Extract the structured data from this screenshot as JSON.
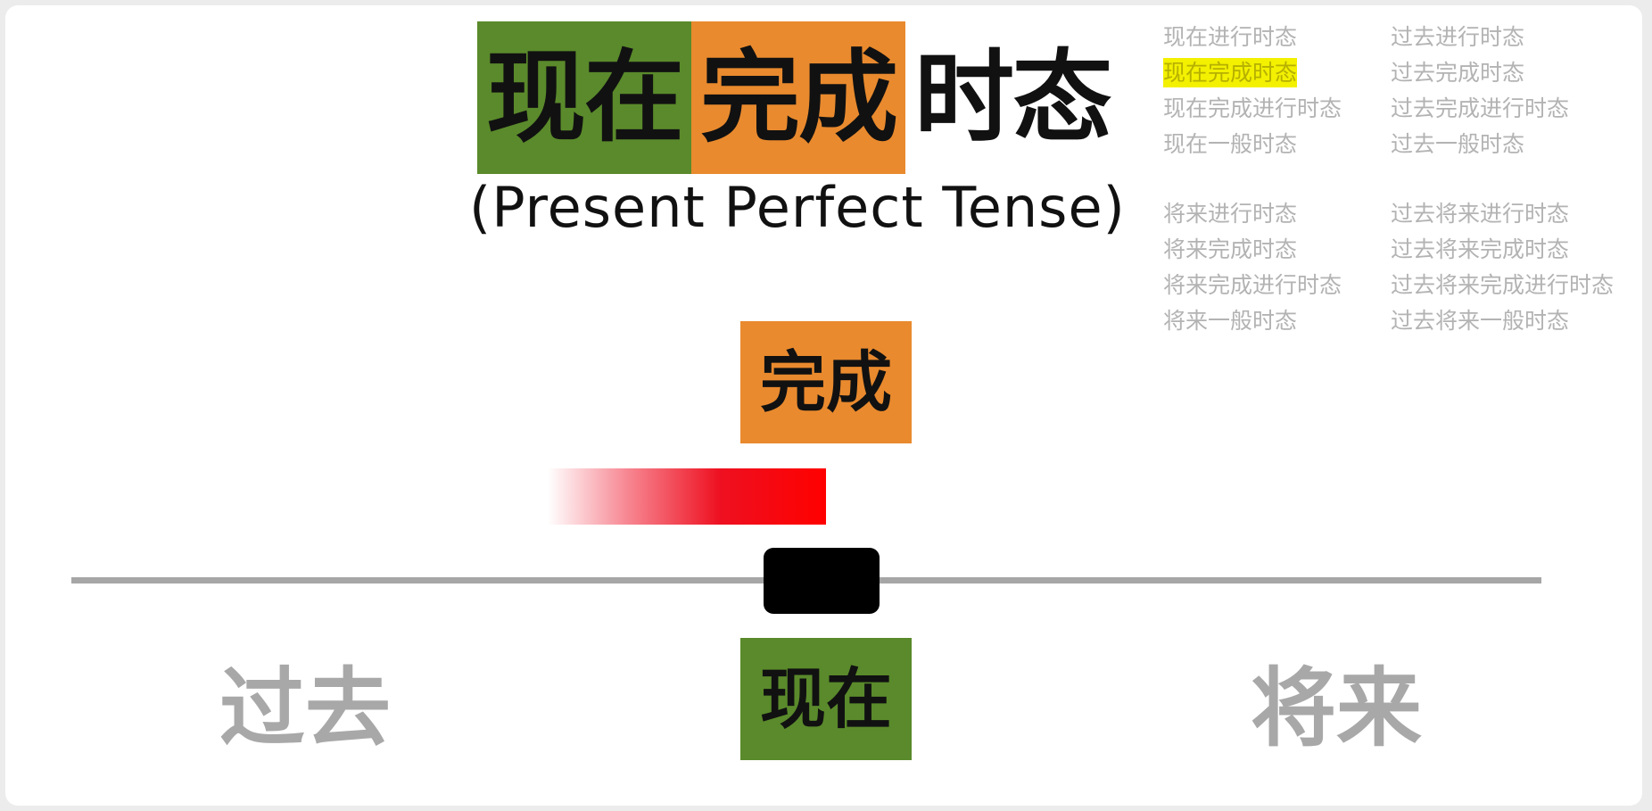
{
  "title": {
    "part_present": "现在",
    "part_perfect": "完成",
    "part_tense": "时态",
    "english": "(Present Perfect Tense)"
  },
  "colors": {
    "present_green": "#5a8a2b",
    "perfect_orange": "#e98a2e",
    "duration_red": "#ff0000",
    "highlight_yellow": "#f3f000",
    "timeline_gray": "#a6a6a6"
  },
  "tense_list": {
    "group1_left": [
      "现在进行时态",
      "现在完成时态",
      "现在完成进行时态",
      "现在一般时态"
    ],
    "group1_right": [
      "过去进行时态",
      "过去完成时态",
      "过去完成进行时态",
      "过去一般时态"
    ],
    "group2_left": [
      "将来进行时态",
      "将来完成时态",
      "将来完成进行时态",
      "将来一般时态"
    ],
    "group2_right": [
      "过去将来进行时态",
      "过去将来完成时态",
      "过去将来完成进行时态",
      "过去将来一般时态"
    ],
    "highlighted": "现在完成时态"
  },
  "diagram": {
    "aspect_label": "完成",
    "now_label": "现在",
    "past_label": "过去",
    "future_label": "将来"
  }
}
